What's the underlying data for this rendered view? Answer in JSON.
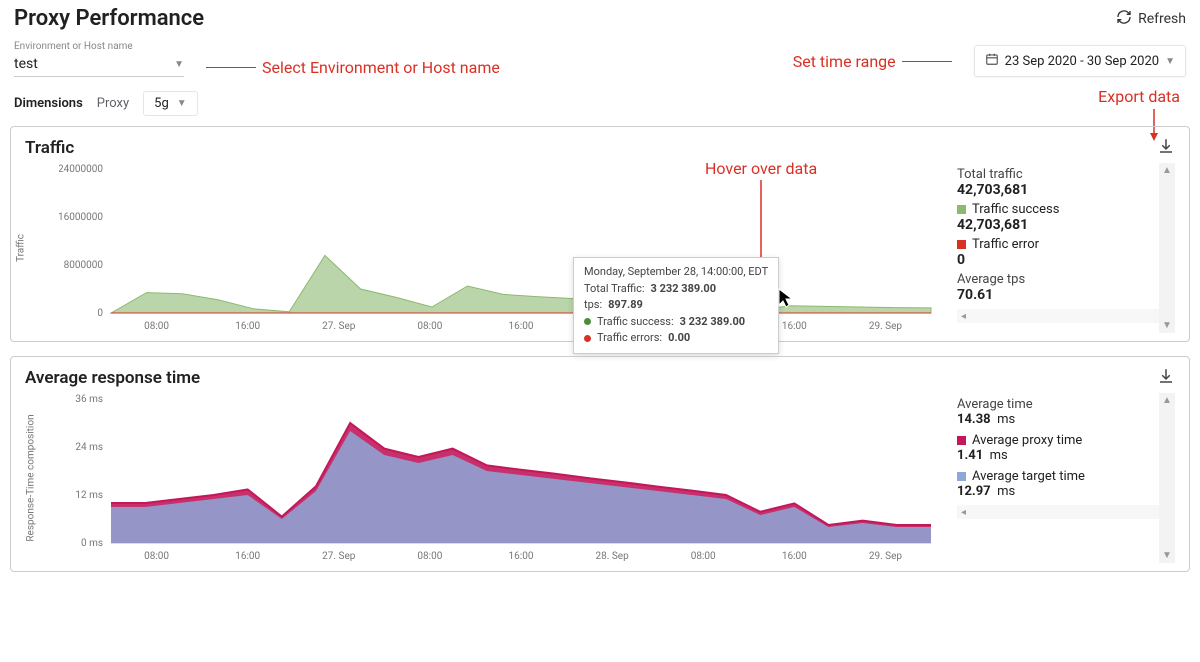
{
  "header": {
    "title": "Proxy Performance",
    "refresh_label": "Refresh"
  },
  "filters": {
    "env_label": "Environment or Host name",
    "env_value": "test",
    "date_range": "23 Sep 2020 - 30 Sep 2020",
    "annot_env": "Select Environment or Host name",
    "annot_date": "Set time range",
    "annot_export": "Export data",
    "annot_hover": "Hover over data"
  },
  "dimensions": {
    "label": "Dimensions",
    "sub": "Proxy",
    "value": "5g"
  },
  "traffic_panel": {
    "title": "Traffic",
    "y_title": "Traffic",
    "side": {
      "total_label": "Total traffic",
      "total_value": "42,703,681",
      "success_label": "Traffic success",
      "success_value": "42,703,681",
      "error_label": "Traffic error",
      "error_value": "0",
      "tps_label": "Average tps",
      "tps_value": "70.61"
    },
    "tooltip": {
      "ts": "Monday, September 28, 14:00:00, EDT",
      "total_label": "Total Traffic:",
      "total_value": "3 232 389.00",
      "tps_label": "tps:",
      "tps_value": "897.89",
      "success_label": "Traffic success:",
      "success_value": "3 232 389.00",
      "errors_label": "Traffic errors:",
      "errors_value": "0.00"
    }
  },
  "response_panel": {
    "title": "Average response time",
    "y_title": "Response-Time composition",
    "side": {
      "avg_label": "Average time",
      "avg_value": "14.38",
      "avg_unit": "ms",
      "proxy_label": "Average proxy time",
      "proxy_value": "1.41",
      "proxy_unit": "ms",
      "target_label": "Average target time",
      "target_value": "12.97",
      "target_unit": "ms"
    }
  },
  "chart_data": [
    {
      "type": "area",
      "title": "Traffic",
      "ylabel": "Traffic",
      "ylim": [
        0,
        24000000
      ],
      "x_ticks": [
        "08:00",
        "16:00",
        "27. Sep",
        "08:00",
        "16:00",
        "28. Sep",
        "08:00",
        "16:00",
        "29. Sep"
      ],
      "y_ticks": [
        0,
        8000000,
        16000000,
        24000000
      ],
      "series": [
        {
          "name": "Traffic success",
          "color": "#8cb96f",
          "values": [
            0,
            3400000,
            3200000,
            2200000,
            700000,
            200000,
            9600000,
            4000000,
            2600000,
            1000000,
            4500000,
            3100000,
            2700000,
            2400000,
            2200000,
            2000000,
            3232389,
            2600000,
            200000,
            1200000,
            1100000,
            1000000,
            900000,
            850000
          ]
        },
        {
          "name": "Traffic error",
          "color": "#d93025",
          "values": [
            0,
            0,
            0,
            0,
            0,
            0,
            0,
            0,
            0,
            0,
            0,
            0,
            0,
            0,
            0,
            0,
            0,
            0,
            0,
            0,
            0,
            0,
            0,
            0
          ]
        }
      ]
    },
    {
      "type": "area",
      "title": "Average response time",
      "ylabel": "Response-Time composition",
      "ylim": [
        0,
        36
      ],
      "y_unit": "ms",
      "x_ticks": [
        "08:00",
        "16:00",
        "27. Sep",
        "08:00",
        "16:00",
        "28. Sep",
        "08:00",
        "16:00",
        "29. Sep"
      ],
      "y_ticks": [
        0,
        12,
        24,
        36
      ],
      "series": [
        {
          "name": "Average target time",
          "color": "#8ca7d8",
          "values": [
            9,
            9,
            10,
            11,
            12,
            6,
            13,
            28,
            22,
            20,
            22,
            18,
            17,
            16,
            15,
            14,
            13,
            12,
            11,
            7,
            9,
            4,
            5,
            4,
            4
          ]
        },
        {
          "name": "Average proxy time",
          "color": "#c2185b",
          "values": [
            1,
            1,
            1,
            1,
            1.4,
            0.6,
            1.2,
            2,
            1.6,
            1.5,
            1.6,
            1.4,
            1.3,
            1.3,
            1.2,
            1.2,
            1.1,
            1.1,
            1,
            0.8,
            0.9,
            0.5,
            0.6,
            0.5,
            0.5
          ]
        }
      ]
    }
  ]
}
